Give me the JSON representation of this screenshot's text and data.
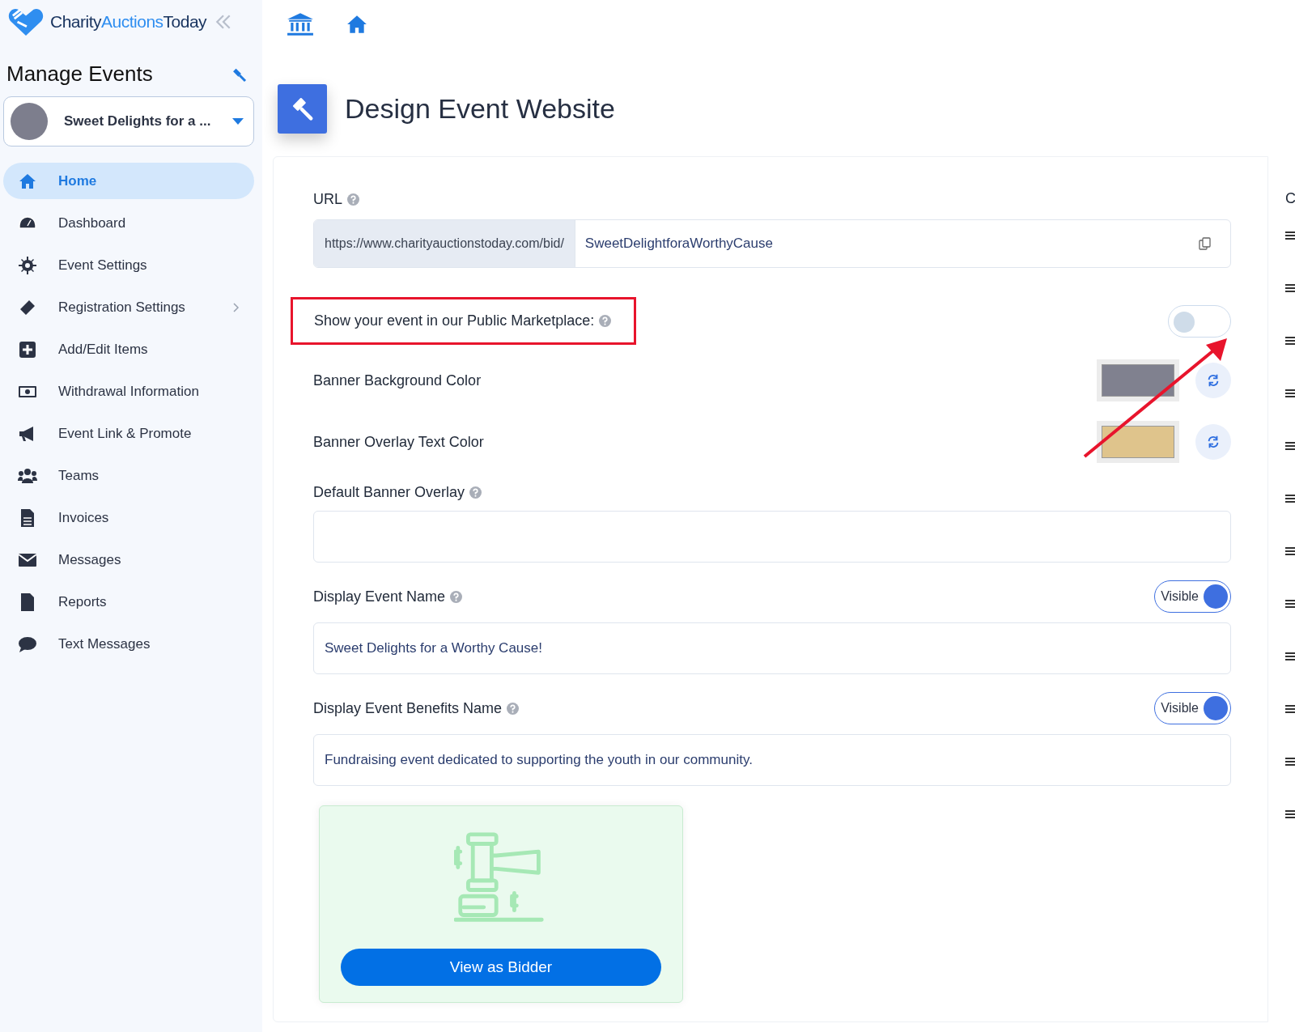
{
  "sidebar": {
    "logo_words": [
      "Charity",
      "Auctions",
      "Today"
    ],
    "title": "Manage Events",
    "event_selector": {
      "value": "Sweet Delights for a ..."
    },
    "items": [
      {
        "label": "Home",
        "selected": true,
        "has_submenu": false
      },
      {
        "label": "Dashboard",
        "selected": false,
        "has_submenu": false
      },
      {
        "label": "Event Settings",
        "selected": false,
        "has_submenu": false
      },
      {
        "label": "Registration Settings",
        "selected": false,
        "has_submenu": true
      },
      {
        "label": "Add/Edit Items",
        "selected": false,
        "has_submenu": false
      },
      {
        "label": "Withdrawal Information",
        "selected": false,
        "has_submenu": false
      },
      {
        "label": "Event Link & Promote",
        "selected": false,
        "has_submenu": false
      },
      {
        "label": "Teams",
        "selected": false,
        "has_submenu": false
      },
      {
        "label": "Invoices",
        "selected": false,
        "has_submenu": false
      },
      {
        "label": "Messages",
        "selected": false,
        "has_submenu": false
      },
      {
        "label": "Reports",
        "selected": false,
        "has_submenu": false
      },
      {
        "label": "Text Messages",
        "selected": false,
        "has_submenu": false
      }
    ]
  },
  "page_title": "Design Event Website",
  "form": {
    "url": {
      "label": "URL",
      "prefix": "https://www.charityauctionstoday.com/bid/",
      "value": "SweetDelightforaWorthyCause"
    },
    "marketplace": {
      "label": "Show your event in our Public Marketplace:",
      "on": false,
      "highlighted": true
    },
    "colors": [
      {
        "label": "Banner Background Color",
        "color": "#80818f"
      },
      {
        "label": "Banner Overlay Text Color",
        "color": "#dfc48c"
      }
    ],
    "default_overlay": {
      "label": "Default Banner Overlay"
    },
    "display_name": {
      "label": "Display Event Name",
      "toggle_label": "Visible",
      "on": true,
      "value": "Sweet Delights for a Worthy Cause!"
    },
    "benefits_name": {
      "label": "Display Event Benefits Name",
      "toggle_label": "Visible",
      "on": true,
      "value": "Fundraising event dedicated to supporting the youth in our community."
    },
    "preview": {
      "button": "View as Bidder"
    }
  },
  "side_column": {
    "heading": "C"
  }
}
